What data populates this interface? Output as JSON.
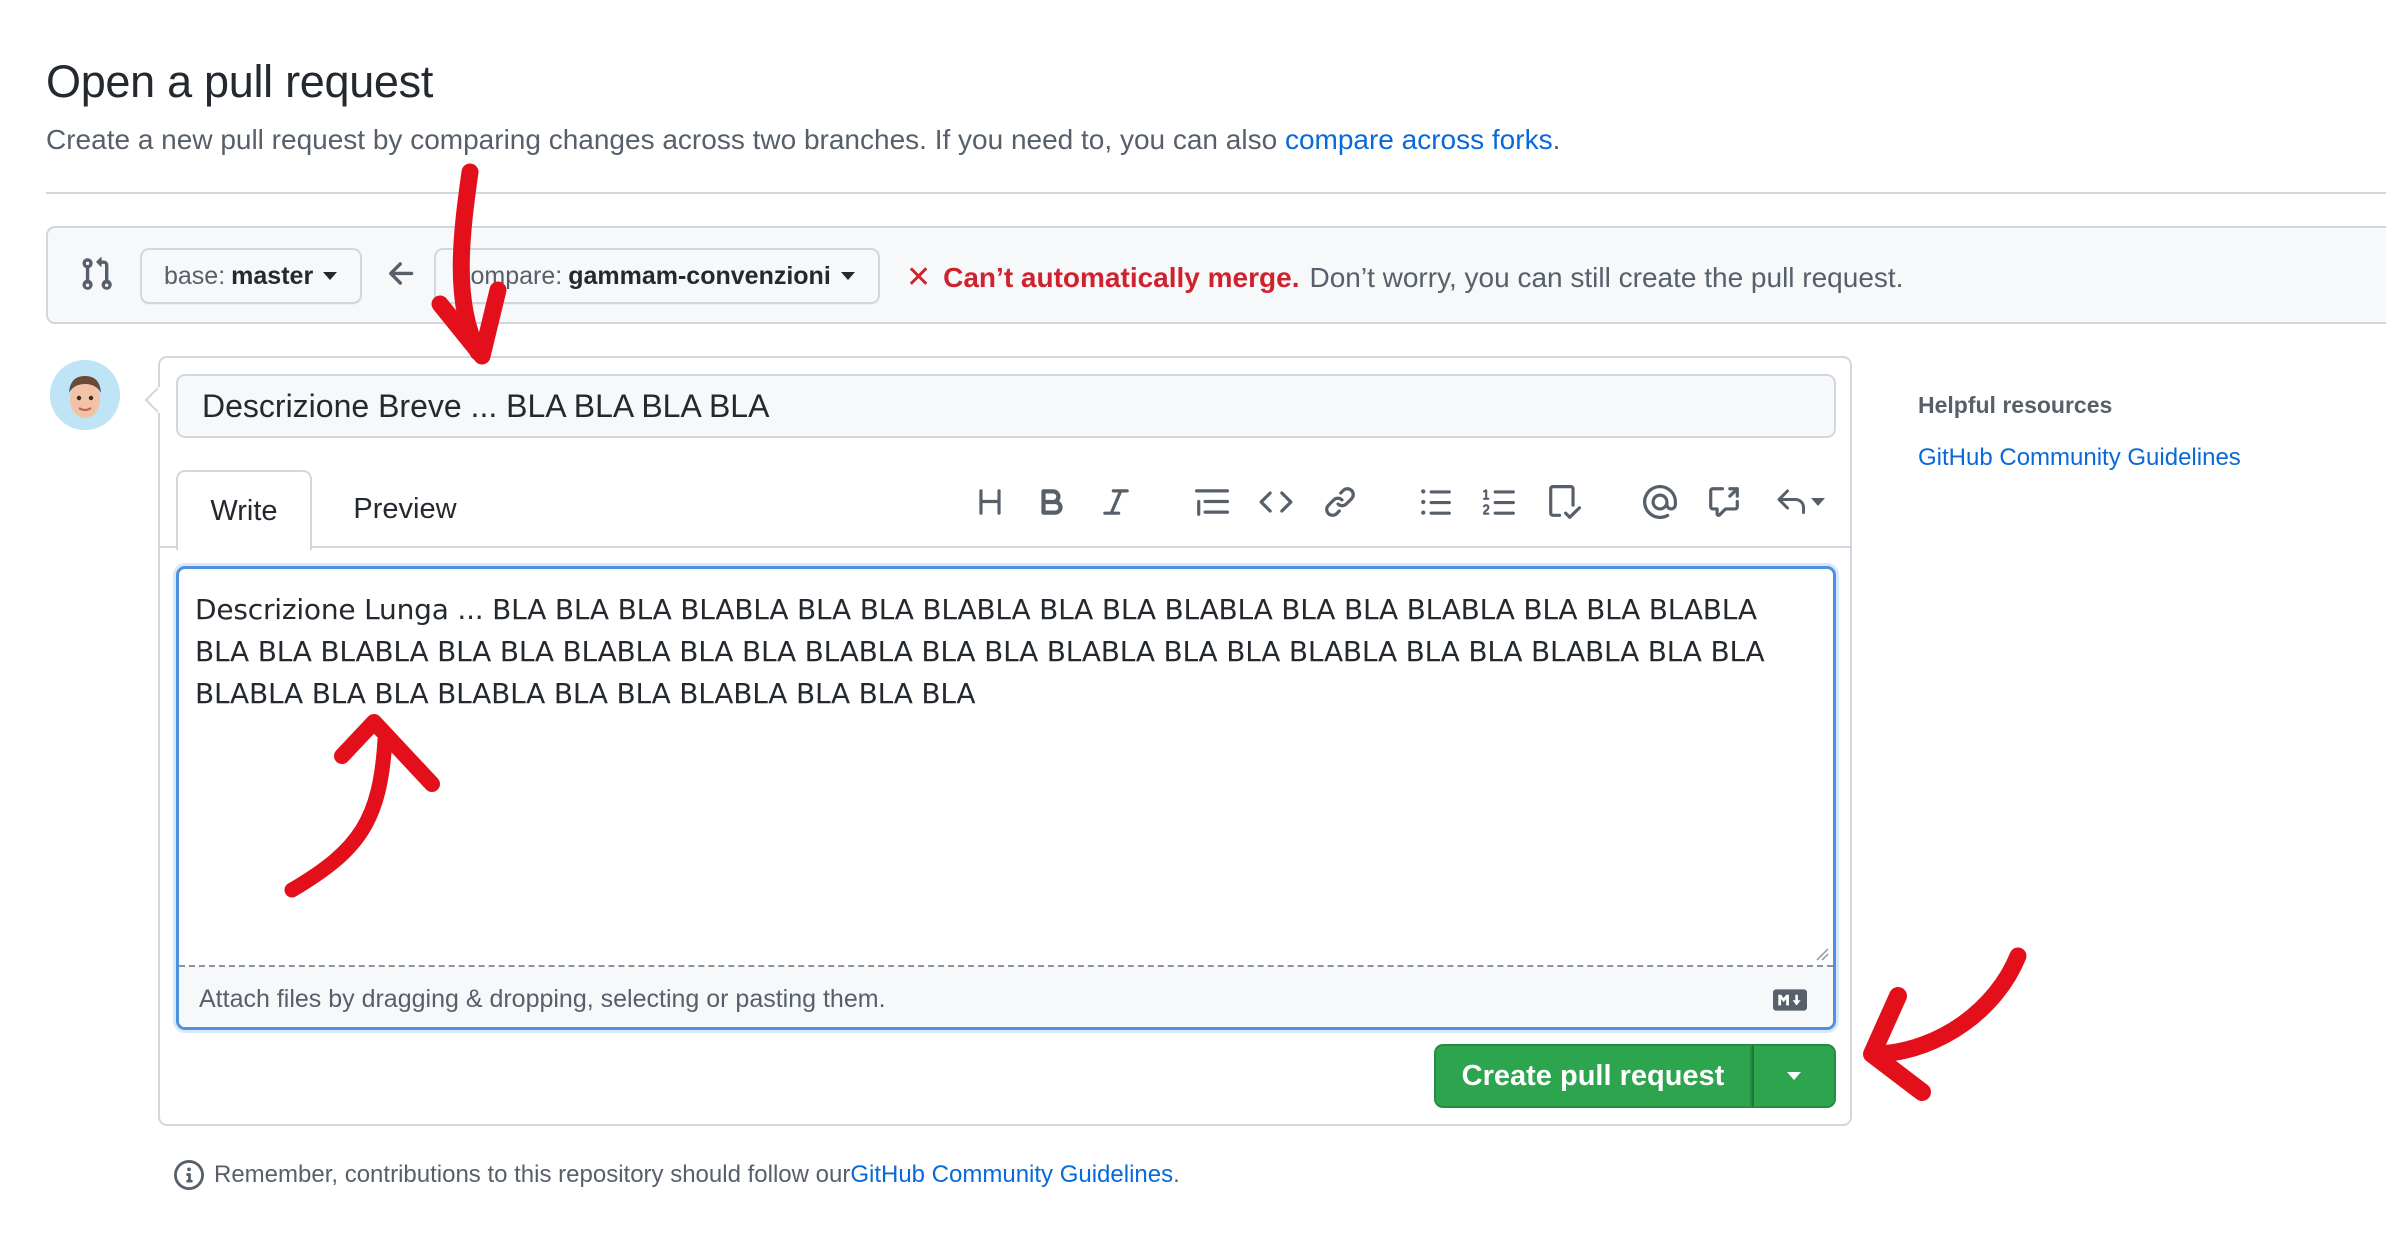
{
  "header": {
    "title": "Open a pull request",
    "subtitle_prefix": "Create a new pull request by comparing changes across two branches. If you need to, you can also ",
    "subtitle_link": "compare across forks",
    "subtitle_suffix": "."
  },
  "range": {
    "base_label": "base:",
    "base_value": "master",
    "compare_label": "compare:",
    "compare_value": "gammam-convenzioni",
    "merge_error_icon": "✕",
    "merge_error": "Can’t automatically merge.",
    "merge_message": "Don’t worry, you can still create the pull request."
  },
  "form": {
    "title_value": "Descrizione Breve ... BLA BLA BLA BLA",
    "tabs": [
      {
        "label": "Write",
        "active": true
      },
      {
        "label": "Preview",
        "active": false
      }
    ],
    "toolbar_icons": [
      "heading-icon",
      "bold-icon",
      "italic-icon",
      "quote-icon",
      "code-icon",
      "link-icon",
      "unordered-list-icon",
      "ordered-list-icon",
      "task-list-icon",
      "mention-icon",
      "cross-reference-icon",
      "reply-icon"
    ],
    "body_value": "Descrizione Lunga ... BLA BLA BLA BLABLA BLA BLA BLABLA BLA BLA BLABLA BLA BLA BLABLA BLA BLA BLABLA BLA BLA BLABLA BLA BLA BLABLA BLA BLA BLABLA BLA BLA BLABLA BLA BLA BLABLA BLA BLA BLABLA BLA BLA BLABLA BLA BLA BLABLA BLA BLA BLABLA BLA BLA BLA",
    "attach_hint": "Attach files by dragging & dropping, selecting or pasting them.",
    "submit_label": "Create pull request"
  },
  "footer": {
    "remember_prefix": "Remember, contributions to this repository should follow our ",
    "remember_link": "GitHub Community Guidelines",
    "remember_suffix": "."
  },
  "sidebar": {
    "title": "Helpful resources",
    "link": "GitHub Community Guidelines"
  },
  "colors": {
    "link": "#0969da",
    "error": "#cf222e",
    "primary_button": "#2da44e",
    "annotation_arrow": "#e3101c"
  }
}
